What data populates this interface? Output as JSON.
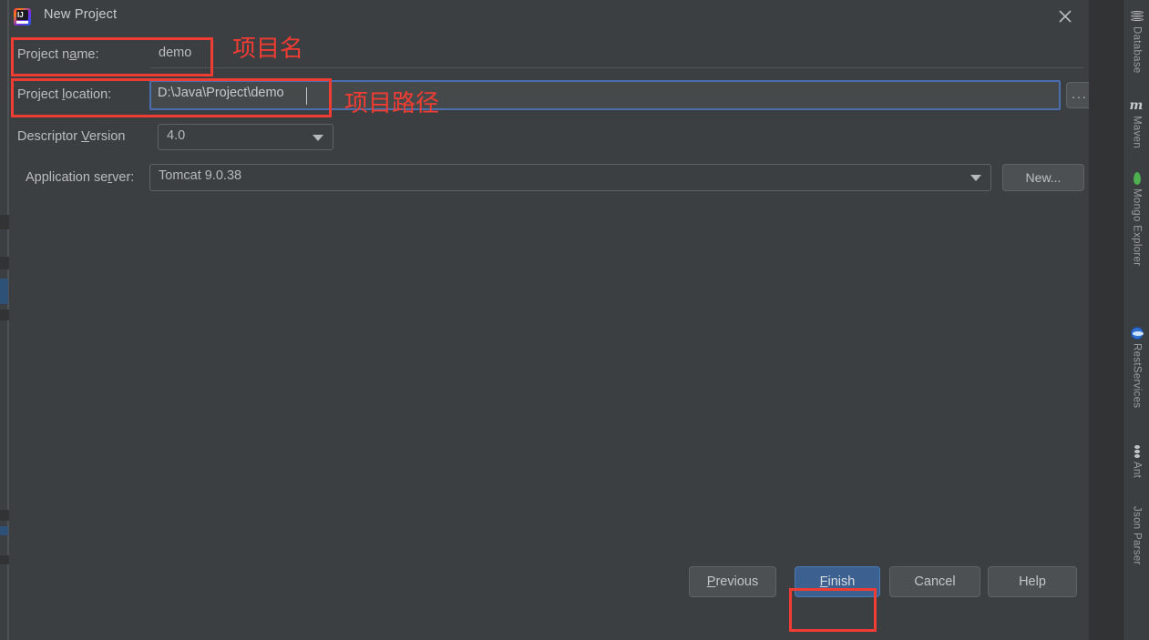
{
  "window": {
    "title": "New Project",
    "app_icon": "intellij-idea-icon",
    "close_icon": "close-icon"
  },
  "form": {
    "project_name": {
      "label": "Project name:",
      "label_mnemonic": "a",
      "value": "demo"
    },
    "project_location": {
      "label": "Project location:",
      "label_mnemonic": "l",
      "value": "D:\\Java\\Project\\demo",
      "browse_button": "...",
      "browse_icon": "ellipsis-icon"
    },
    "descriptor_version": {
      "label": "Descriptor Version",
      "label_mnemonic": "V",
      "value": "4.0",
      "dropdown_icon": "chevron-down-icon"
    },
    "application_server": {
      "label": "Application server:",
      "label_mnemonic": "r",
      "value": "Tomcat 9.0.38",
      "dropdown_icon": "chevron-down-icon",
      "new_button": "New..."
    }
  },
  "footer": {
    "previous": "Previous",
    "previous_mnemonic": "P",
    "finish": "Finish",
    "finish_mnemonic": "F",
    "cancel": "Cancel",
    "help": "Help"
  },
  "annotations": [
    {
      "text": "项目名",
      "meaning": "project-name-annotation"
    },
    {
      "text": "项目路径",
      "meaning": "project-location-annotation"
    }
  ],
  "toolstrip": {
    "items": [
      {
        "label": "Database",
        "icon": "database-icon"
      },
      {
        "label": "Maven",
        "icon": "maven-icon"
      },
      {
        "label": "Mongo Explorer",
        "icon": "mongo-leaf-icon"
      },
      {
        "label": "RestServices",
        "icon": "globe-icon"
      },
      {
        "label": "Ant",
        "icon": "ant-icon"
      },
      {
        "label": "Json Parser",
        "icon": "json-parser-icon"
      }
    ]
  },
  "colors": {
    "background": "#3c3f41",
    "accent_blue": "#4b6eaf",
    "primary_button": "#3c6190",
    "annotation_red": "#f03c32",
    "text": "#babdbe"
  }
}
